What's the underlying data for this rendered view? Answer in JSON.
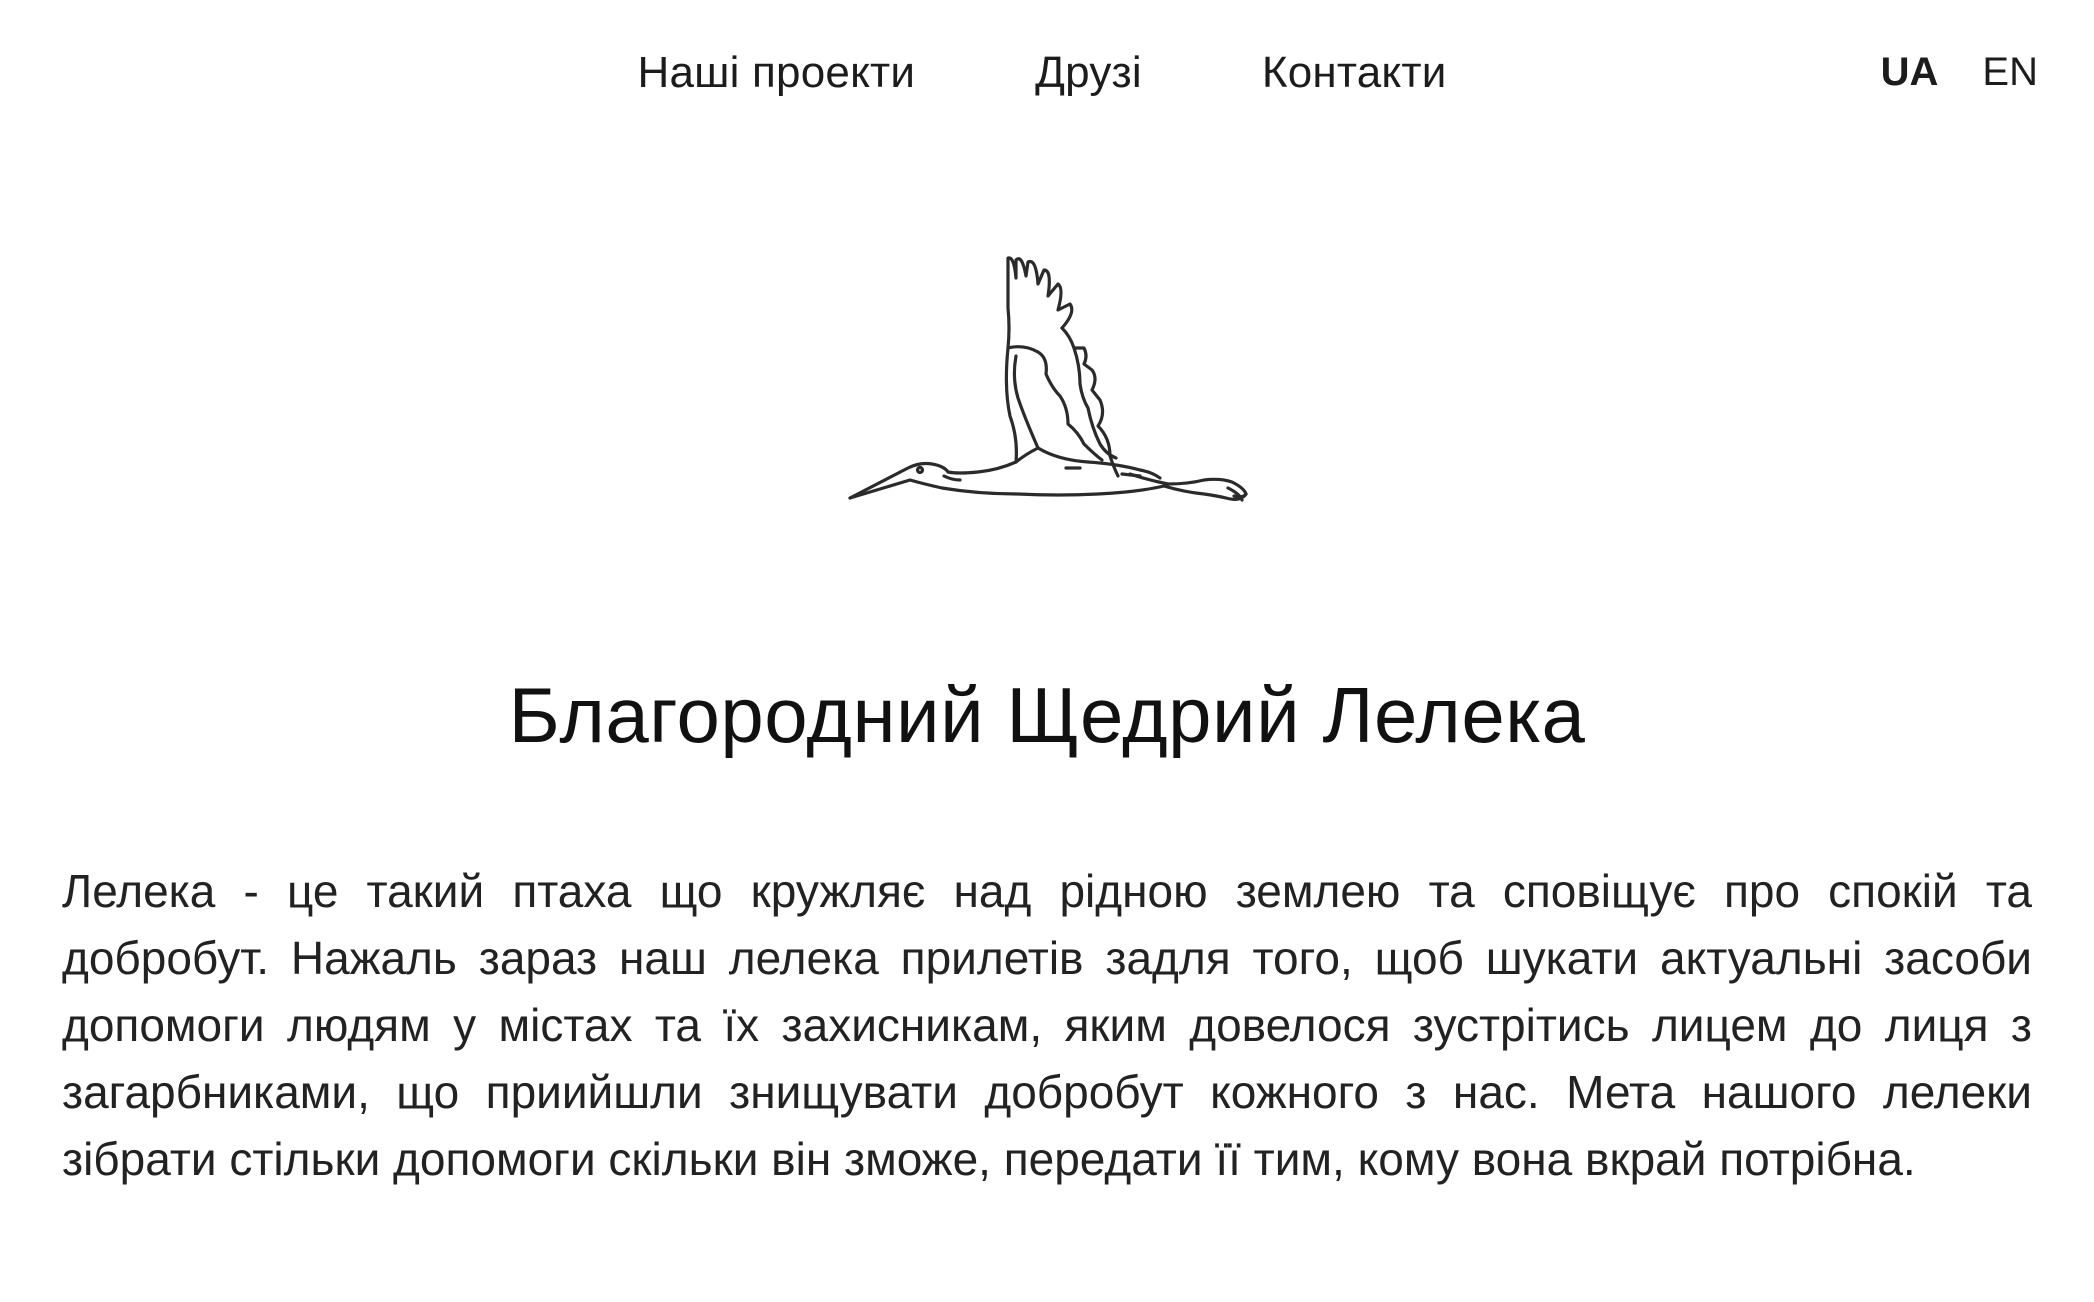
{
  "nav": {
    "links": [
      {
        "label": "Наші проекти"
      },
      {
        "label": "Друзі"
      },
      {
        "label": "Контакти"
      }
    ],
    "languages": {
      "active": "UA",
      "other": "EN"
    }
  },
  "logo": {
    "icon": "stork-icon"
  },
  "main": {
    "title": "Благородний Щедрий Лелека",
    "description": "Лелека - це такий птаха що кружляє над рідною землею та сповіщує про спокій та добробут. Нажаль зараз наш лелека прилетів задля того, щоб шукати актуальні засоби допомоги людям у містах та їх захисникам, яким довелося зустрітись лицем до лиця з загарбниками, що приийшли знищувати добробут кожного з нас. Мета нашого лелеки зібрати стільки допомоги скільки він зможе, передати її тим, кому вона вкрай потрібна."
  }
}
